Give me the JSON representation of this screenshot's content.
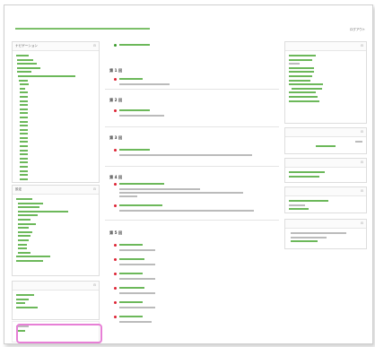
{
  "page": {
    "topright_link": "ログアウト"
  },
  "highlight": {
    "color": "#e77fd6"
  },
  "accent": "#3a9a2a",
  "sections": [
    {
      "title": "第 1 回"
    },
    {
      "title": "第 2 回"
    },
    {
      "title": "第 3 回"
    },
    {
      "title": "第 4 回"
    },
    {
      "title": "第 5 回"
    }
  ],
  "blocks": {
    "nav": {
      "title": "ナビゲーション",
      "icon": "collapse-icon"
    },
    "settings": {
      "title": "設定",
      "icon": "collapse-icon"
    },
    "admin_group": {
      "title": "",
      "icon": "collapse-icon"
    },
    "bottom": {
      "title": ""
    },
    "right1": {
      "title": "",
      "icon": "collapse-icon"
    },
    "right2": {
      "title": "",
      "icon": "collapse-icon"
    },
    "right3": {
      "title": "",
      "icon": "collapse-icon"
    },
    "right4": {
      "title": "",
      "icon": "collapse-icon"
    },
    "right5": {
      "title": "",
      "icon": "collapse-icon"
    }
  }
}
